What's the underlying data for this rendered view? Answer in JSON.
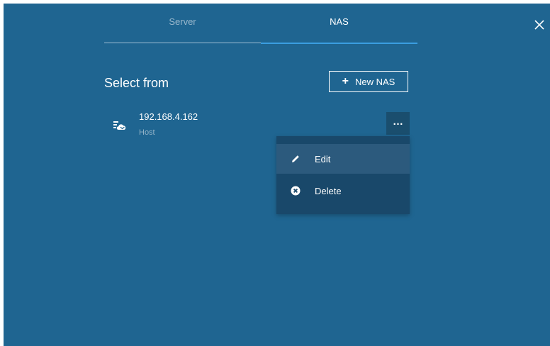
{
  "tabs": [
    {
      "label": "Server",
      "active": false
    },
    {
      "label": "NAS",
      "active": true
    }
  ],
  "close_icon": "close-icon",
  "heading": "Select from",
  "new_button": {
    "icon": "plus-icon",
    "label": "New NAS"
  },
  "nas_list": [
    {
      "icon": "nas-cloud-icon",
      "ip": "192.168.4.162",
      "role": "Host",
      "more_label": "…"
    }
  ],
  "menu": {
    "items": [
      {
        "icon": "pencil-icon",
        "label": "Edit",
        "highlighted": true
      },
      {
        "icon": "close-circle-icon",
        "label": "Delete",
        "highlighted": false
      }
    ]
  },
  "colors": {
    "background": "#1f6591",
    "accent": "#3a9de0",
    "menu_bg": "#19486a",
    "menu_hover": "#2c5a7d",
    "muted_text": "#94b4c8"
  }
}
